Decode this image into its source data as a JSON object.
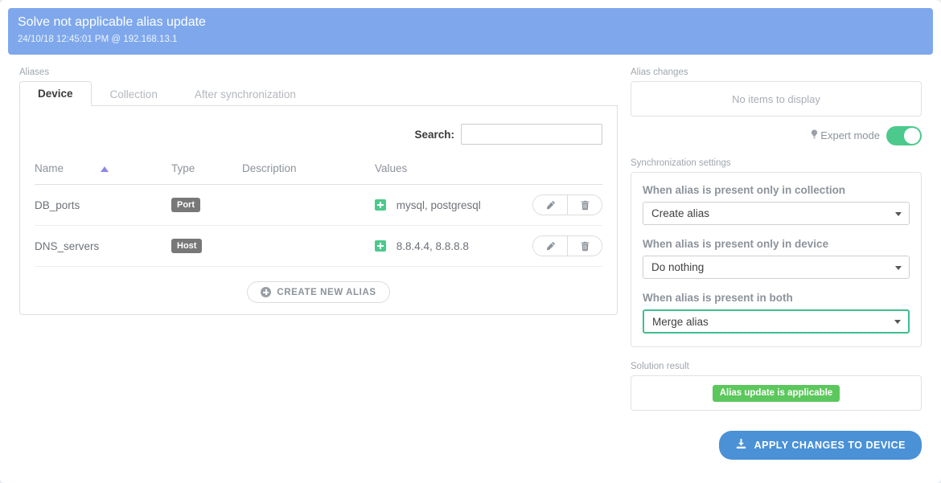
{
  "header": {
    "title": "Solve not applicable alias update",
    "subtitle": "24/10/18 12:45:01 PM @ 192.168.13.1"
  },
  "left": {
    "section_label": "Aliases",
    "tabs": [
      {
        "label": "Device",
        "active": true
      },
      {
        "label": "Collection",
        "active": false
      },
      {
        "label": "After synchronization",
        "active": false
      }
    ],
    "search": {
      "label": "Search:",
      "value": "",
      "placeholder": ""
    },
    "table": {
      "columns": [
        "Name",
        "Type",
        "Description",
        "Values"
      ],
      "sort_column": "Name",
      "sort_direction": "asc",
      "rows": [
        {
          "name": "DB_ports",
          "type": "Port",
          "description": "",
          "values": "mysql, postgresql"
        },
        {
          "name": "DNS_servers",
          "type": "Host",
          "description": "",
          "values": "8.8.4.4, 8.8.8.8"
        }
      ],
      "row_actions": [
        "edit-icon",
        "trash-icon"
      ]
    },
    "create_button": "CREATE NEW ALIAS"
  },
  "right": {
    "alias_changes": {
      "label": "Alias changes",
      "empty_text": "No items to display"
    },
    "expert_mode": {
      "label": "Expert mode",
      "icon": "lightbulb-icon",
      "enabled": true
    },
    "sync_settings": {
      "label": "Synchronization settings",
      "fields": [
        {
          "label": "When alias is present only in collection",
          "value": "Create alias",
          "focused": false
        },
        {
          "label": "When alias is present only in device",
          "value": "Do nothing",
          "focused": false
        },
        {
          "label": "When alias is present in both",
          "value": "Merge alias",
          "focused": true
        }
      ]
    },
    "solution_result": {
      "label": "Solution result",
      "badge": "Alias update is applicable"
    },
    "apply_button": {
      "label": "APPLY CHANGES TO DEVICE",
      "icon": "download-icon"
    }
  },
  "colors": {
    "header_blue": "#7fa8ec",
    "accent_green": "#4cc98c",
    "badge_green": "#5cc75c",
    "apply_blue": "#4a91d6",
    "type_badge_gray": "#787878",
    "page_bg": "#e9edf2",
    "sort_arrow": "#8e87e8"
  }
}
